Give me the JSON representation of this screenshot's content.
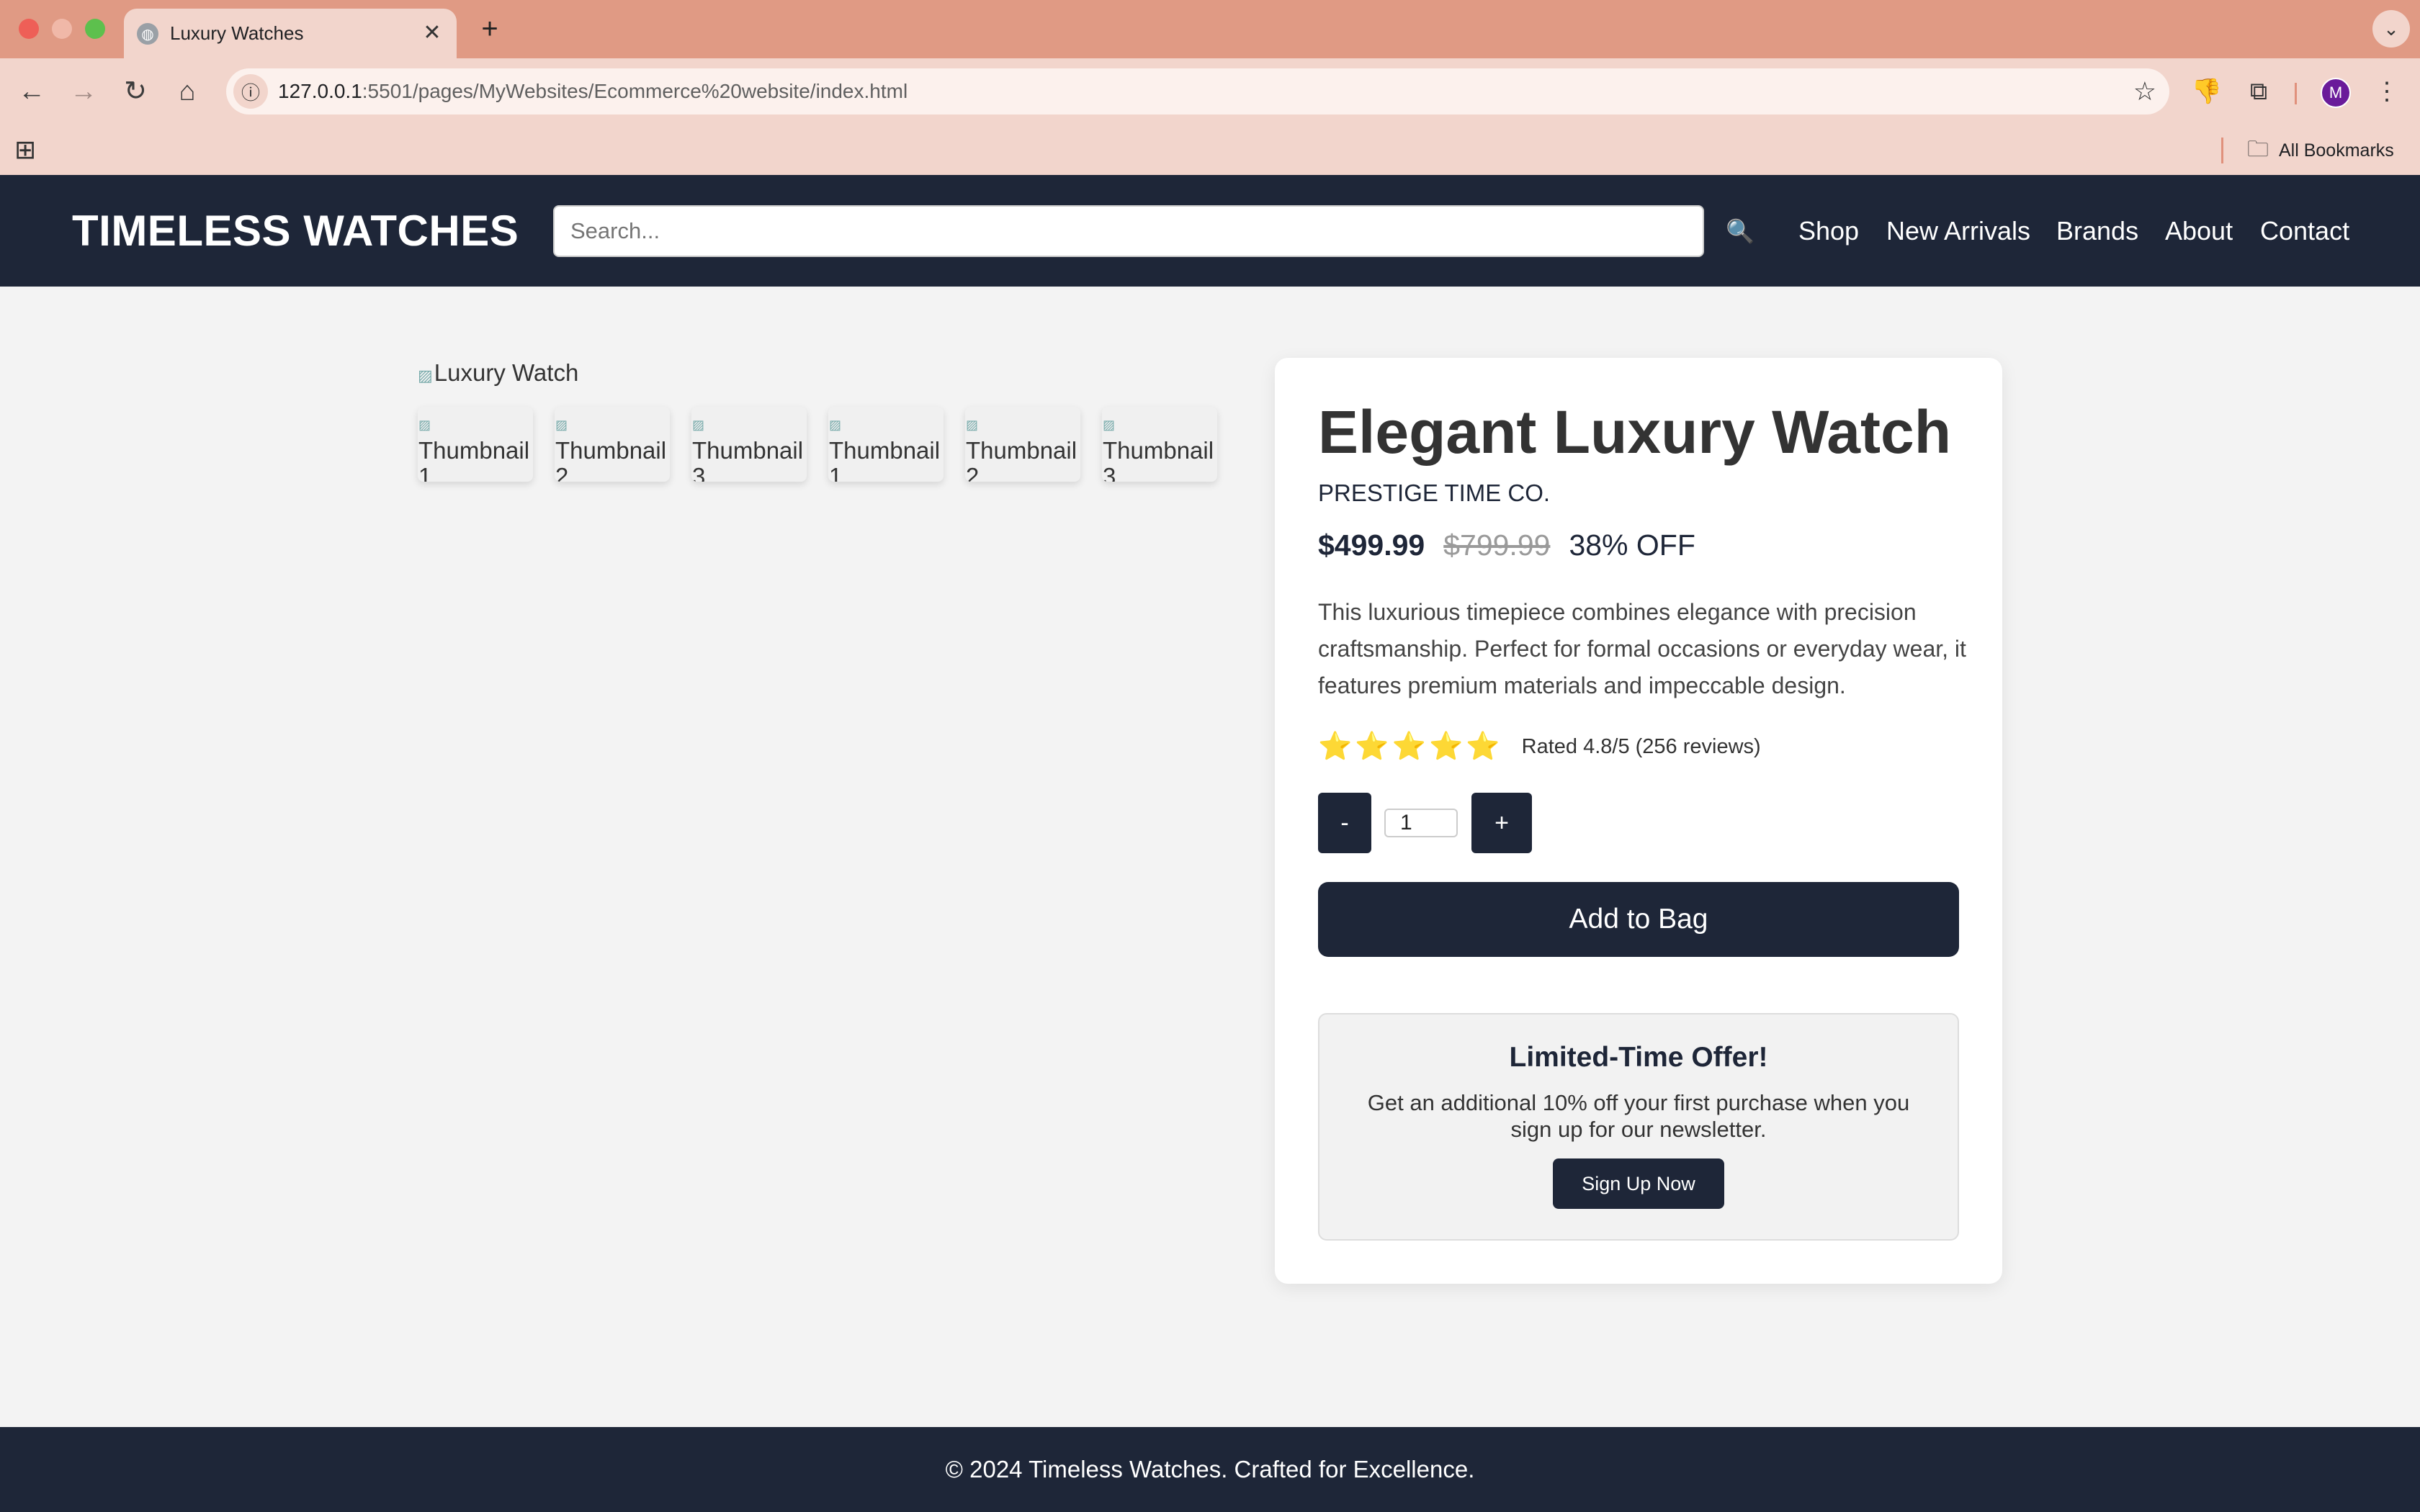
{
  "browser": {
    "tab_title": "Luxury Watches",
    "tab_close": "✕",
    "new_tab": "+",
    "tab_menu": "⌄",
    "url_host": "127.0.0.1",
    "url_path": ":5501/pages/MyWebsites/Ecommerce%20website/index.html",
    "profile_initial": "M",
    "all_bookmarks": "All Bookmarks",
    "traffic_colors": {
      "close": "#ee5f57",
      "minimize": "#f0b8a8",
      "maximize": "#5dc04d"
    },
    "chrome_color": "#e09a84"
  },
  "header": {
    "brand": "TIMELESS WATCHES",
    "search_placeholder": "Search...",
    "search_icon": "🔍",
    "nav": [
      "Shop",
      "New Arrivals",
      "Brands",
      "About",
      "Contact"
    ],
    "bg_color": "#1e2638"
  },
  "gallery": {
    "main_alt": "Luxury Watch",
    "thumbnails": [
      "Thumbnail 1",
      "Thumbnail 2",
      "Thumbnail 3",
      "Thumbnail 1",
      "Thumbnail 2",
      "Thumbnail 3"
    ]
  },
  "product": {
    "title": "Elegant Luxury Watch",
    "brand": "PRESTIGE TIME CO.",
    "price": "$499.99",
    "original_price": "$799.99",
    "discount": "38% OFF",
    "description": "This luxurious timepiece combines elegance with precision craftsmanship. Perfect for formal occasions or everyday wear, it features premium materials and impeccable design.",
    "stars": 5,
    "rating_text": "Rated 4.8/5 (256 reviews)",
    "qty_minus": "-",
    "qty_plus": "+",
    "quantity": "1",
    "add_to_bag": "Add to Bag"
  },
  "offer": {
    "title": "Limited-Time Offer!",
    "text": "Get an additional 10% off your first purchase when you sign up for our newsletter.",
    "button": "Sign Up Now"
  },
  "footer": {
    "text": "© 2024 Timeless Watches. Crafted for Excellence."
  }
}
